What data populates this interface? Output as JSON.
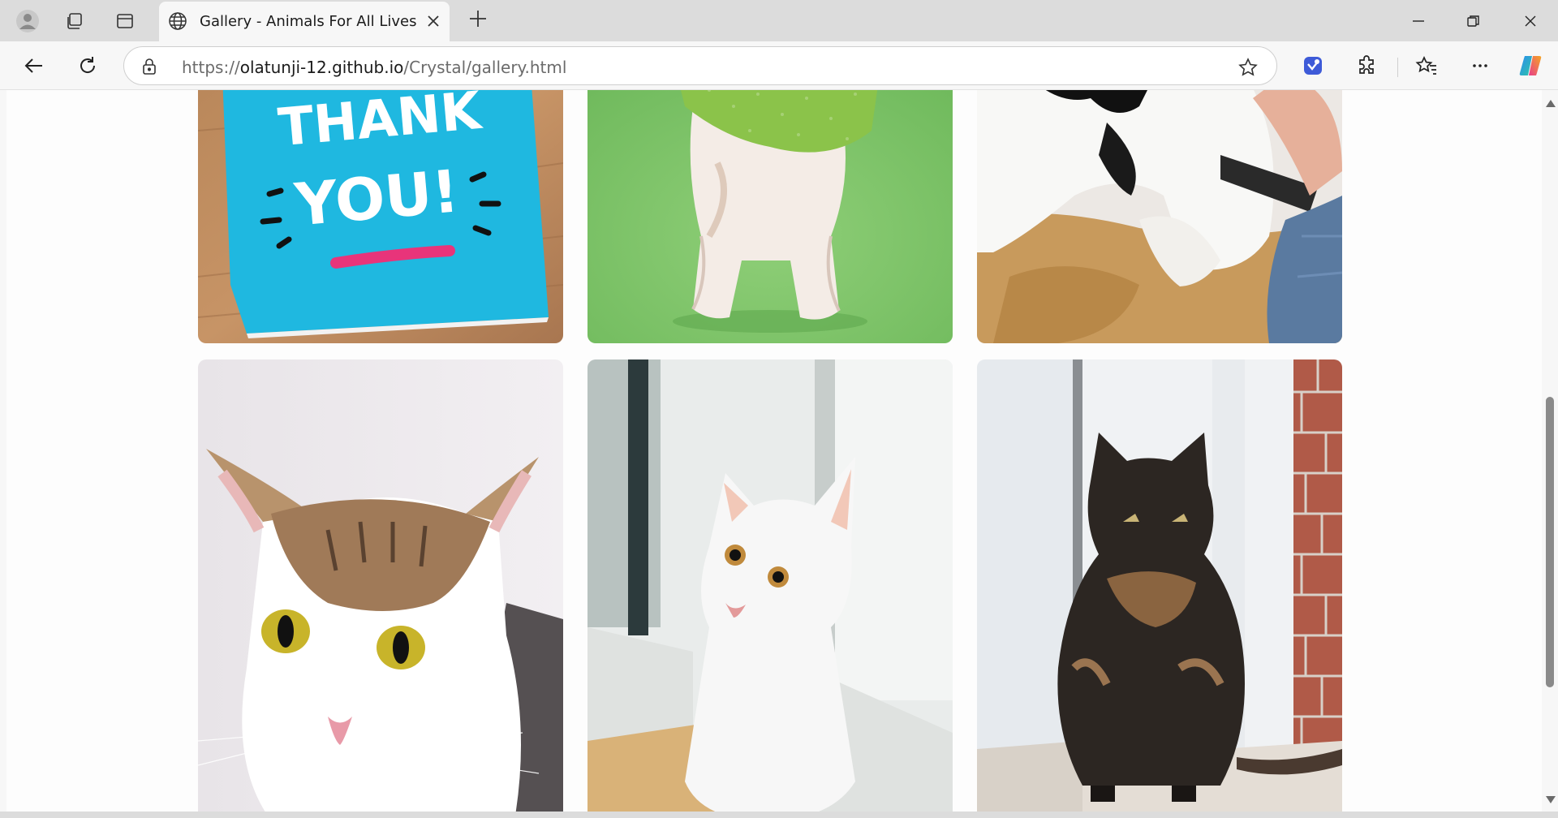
{
  "browser": {
    "tab": {
      "title": "Gallery - Animals For All Lives",
      "icon": "globe-icon"
    },
    "address_bar": {
      "scheme": "https://",
      "host": "olatunji-12.github.io",
      "path": "/Crystal/gallery.html"
    },
    "toolbar_icons": [
      "back-icon",
      "refresh-icon",
      "site-info-icon",
      "favorite-star-icon",
      "copilot-vision-icon",
      "extensions-icon",
      "favorites-icon",
      "more-icon",
      "copilot-icon"
    ],
    "window_controls": [
      "minimize-icon",
      "restore-icon",
      "close-icon"
    ]
  },
  "gallery": {
    "photos": [
      {
        "subject": "thank-you-card",
        "text": "THANK YOU!"
      },
      {
        "subject": "white-dog-green-bandana"
      },
      {
        "subject": "black-white-dog-on-couch"
      },
      {
        "subject": "tabby-white-cat"
      },
      {
        "subject": "white-kitten"
      },
      {
        "subject": "tortoiseshell-cat"
      }
    ]
  },
  "colors": {
    "accent": "#0f6cbd",
    "card_blue": "#1fb8e0",
    "green_backdrop": "#7fc46a"
  }
}
